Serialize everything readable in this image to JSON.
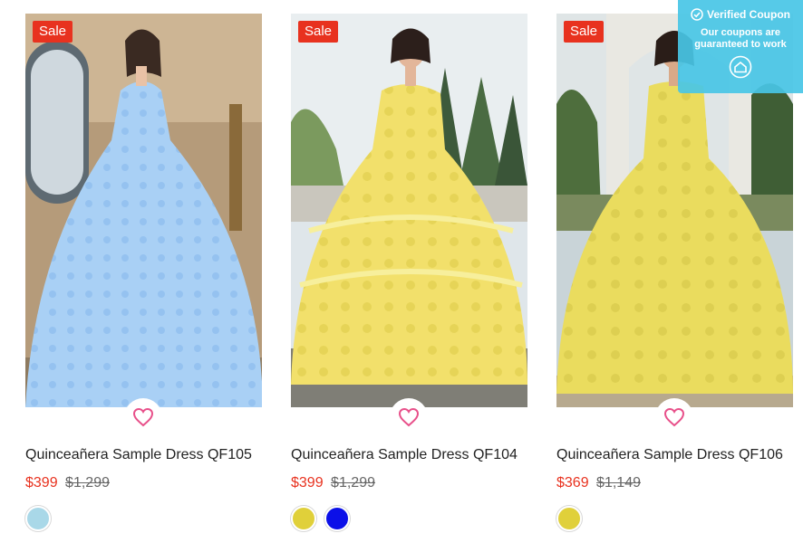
{
  "products": [
    {
      "title": "Quinceañera Sample Dress QF105",
      "badge": "Sale",
      "price": "$399",
      "old_price": "$1,299",
      "dress_color": "#a9d0f5",
      "swatches": [
        {
          "name": "Light Blue",
          "color": "#a9d8e8"
        }
      ]
    },
    {
      "title": "Quinceañera Sample Dress QF104",
      "badge": "Sale",
      "price": "$399",
      "old_price": "$1,299",
      "dress_color": "#f2e06b",
      "swatches": [
        {
          "name": "Yellow",
          "color": "#e0d03a"
        },
        {
          "name": "Royal Blue",
          "color": "#0b10e8"
        }
      ]
    },
    {
      "title": "Quinceañera Sample Dress QF106",
      "badge": "Sale",
      "price": "$369",
      "old_price": "$1,149",
      "dress_color": "#eadc5e",
      "swatches": [
        {
          "name": "Yellow",
          "color": "#e0d03a"
        }
      ]
    }
  ],
  "coupon": {
    "title": "Verified Coupon",
    "text": "Our coupons are guaranteed to work"
  },
  "colors": {
    "sale": "#e8321f",
    "heart": "#e8508a",
    "coupon_bg": "#48c6e6"
  }
}
